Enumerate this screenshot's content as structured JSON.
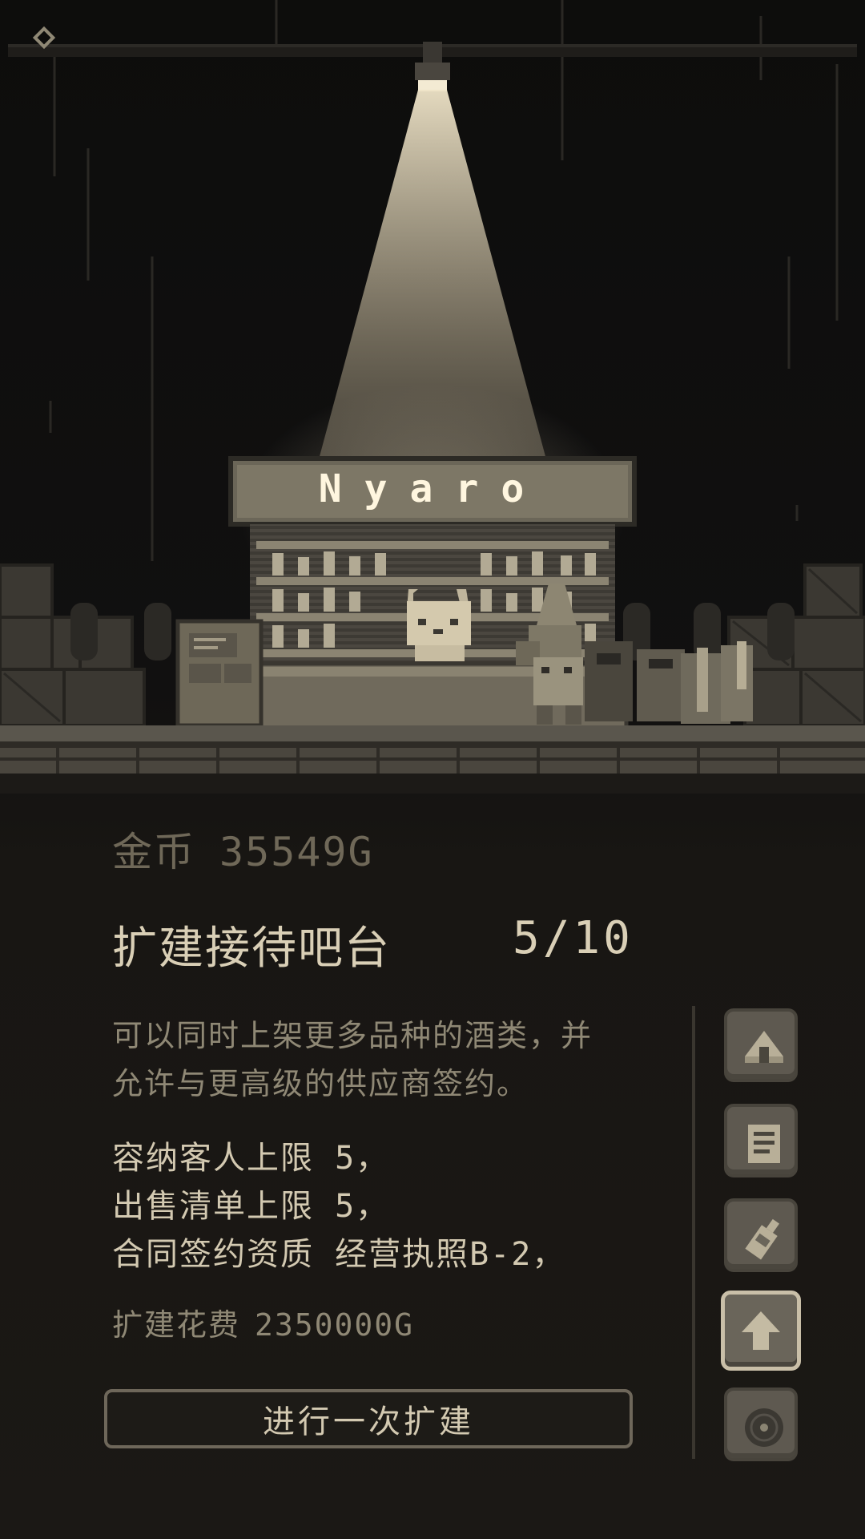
{
  "shop": {
    "sign_text": "Nyaro"
  },
  "panel": {
    "gold_label": "金币",
    "gold_value": "35549G",
    "title": "扩建接待吧台",
    "level": "5/10",
    "description_lines": [
      "可以同时上架更多品种的酒类，并",
      "允许与更高级的供应商签约。"
    ],
    "stats": [
      "容纳客人上限 5，",
      "出售清单上限 5，",
      "合同签约资质 经营执照B-2，"
    ],
    "cost_label": "扩建花费",
    "cost_value": "2350000G",
    "expand_button": "进行一次扩建"
  },
  "side_menu": {
    "icons": [
      "tent-icon",
      "document-icon",
      "bottle-icon",
      "upgrade-arrow-icon",
      "record-disc-icon"
    ],
    "active_index": 3
  },
  "colors": {
    "background": "#0f0e0c",
    "text_main": "#d9cfb6",
    "text_dim": "#8f8875",
    "button_bg": "#5e5950",
    "spotlight": "#e8dcbf"
  }
}
